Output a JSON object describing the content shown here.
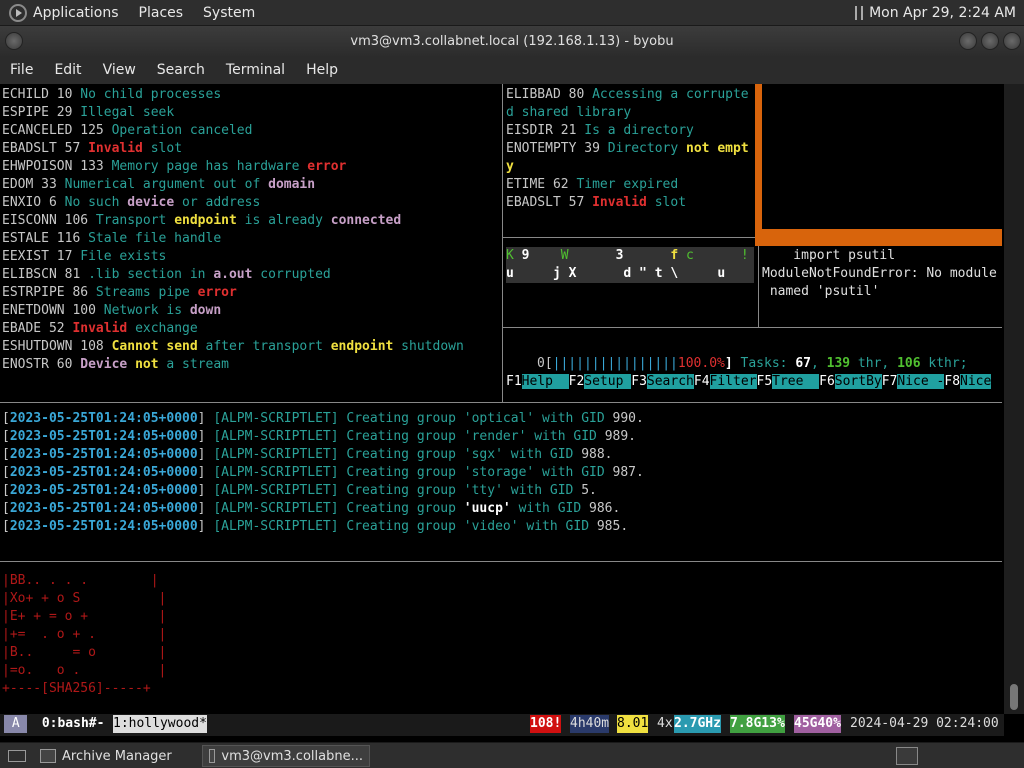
{
  "topbar": {
    "menus": [
      "Applications",
      "Places",
      "System"
    ],
    "datetime": "Mon Apr 29, 2:24 AM"
  },
  "window": {
    "title": "vm3@vm3.collabnet.local (192.168.1.13) - byobu"
  },
  "menubar": [
    "File",
    "Edit",
    "View",
    "Search",
    "Terminal",
    "Help"
  ],
  "errno_left": [
    [
      [
        "ECHILD 10 ",
        "w"
      ],
      [
        "No child processes",
        "c"
      ]
    ],
    [
      [
        "ESPIPE 29 ",
        "w"
      ],
      [
        "Illegal seek",
        "c"
      ]
    ],
    [
      [
        "ECANCELED 125 ",
        "w"
      ],
      [
        "Operation canceled",
        "c"
      ]
    ],
    [
      [
        "EBADSLT 57 ",
        "w"
      ],
      [
        "Invalid",
        "r"
      ],
      [
        " slot",
        "c"
      ]
    ],
    [
      [
        "EHWPOISON 133 ",
        "w"
      ],
      [
        "Memory page has hardware ",
        "c"
      ],
      [
        "error",
        "r"
      ]
    ],
    [
      [
        "EDOM 33 ",
        "w"
      ],
      [
        "Numerical argument out of ",
        "c"
      ],
      [
        "domain",
        "m"
      ]
    ],
    [
      [
        "ENXIO 6 ",
        "w"
      ],
      [
        "No such ",
        "c"
      ],
      [
        "device",
        "m"
      ],
      [
        " or address",
        "c"
      ]
    ],
    [
      [
        "EISCONN 106 ",
        "w"
      ],
      [
        "Transport ",
        "c"
      ],
      [
        "endpoint",
        "y"
      ],
      [
        " is already ",
        "c"
      ],
      [
        "connected",
        "m"
      ]
    ],
    [
      [
        "ESTALE 116 ",
        "w"
      ],
      [
        "Stale file handle",
        "c"
      ]
    ],
    [
      [
        "EEXIST 17 ",
        "w"
      ],
      [
        "File exists",
        "c"
      ]
    ],
    [
      [
        "ELIBSCN 81 ",
        "w"
      ],
      [
        ".lib section in ",
        "c"
      ],
      [
        "a.out",
        "m"
      ],
      [
        " corrupted",
        "c"
      ]
    ],
    [
      [
        "ESTRPIPE 86 ",
        "w"
      ],
      [
        "Streams pipe ",
        "c"
      ],
      [
        "error",
        "r"
      ]
    ],
    [
      [
        "ENETDOWN 100 ",
        "w"
      ],
      [
        "Network is ",
        "c"
      ],
      [
        "down",
        "m"
      ]
    ],
    [
      [
        "EBADE 52 ",
        "w"
      ],
      [
        "Invalid",
        "r"
      ],
      [
        " exchange",
        "c"
      ]
    ],
    [
      [
        "ESHUTDOWN 108 ",
        "w"
      ],
      [
        "Cannot send",
        "y"
      ],
      [
        " after transport ",
        "c"
      ],
      [
        "endpoint",
        "y"
      ],
      [
        " shutdown",
        "c"
      ]
    ],
    [
      [
        "ENOSTR 60 ",
        "w"
      ],
      [
        "Device",
        "m"
      ],
      [
        " ",
        "w"
      ],
      [
        "not",
        "y"
      ],
      [
        " a stream",
        "c"
      ]
    ]
  ],
  "errno_right": [
    [
      [
        "ELIBBAD 80 ",
        "w"
      ],
      [
        "Accessing a corrupte",
        "c"
      ]
    ],
    [
      [
        "d shared library",
        "c"
      ]
    ],
    [
      [
        "EISDIR 21 ",
        "w"
      ],
      [
        "Is a directory",
        "c"
      ]
    ],
    [
      [
        "ENOTEMPTY 39 ",
        "w"
      ],
      [
        "Directory ",
        "c"
      ],
      [
        "not empt",
        "y"
      ]
    ],
    [
      [
        "y",
        "y"
      ]
    ],
    [
      [
        "ETIME 62 ",
        "w"
      ],
      [
        "Timer expired",
        "c"
      ]
    ],
    [
      [
        "EBADSLT 57 ",
        "w"
      ],
      [
        "Invalid",
        "r"
      ],
      [
        " slot",
        "c"
      ]
    ]
  ],
  "gauge_row1": [
    [
      "K",
      "g"
    ],
    [
      " 9    ",
      "bw"
    ],
    [
      "W",
      "g"
    ],
    [
      "      3      ",
      "bw"
    ],
    [
      "f",
      "y"
    ],
    [
      " c      !",
      "g"
    ]
  ],
  "gauge_row2": "u     j X      d \" t \\     u",
  "python": [
    "    import psutil",
    "ModuleNotFoundError: No module",
    " named 'psutil'"
  ],
  "htop": {
    "cpu_label": "0[",
    "cpu_bar": "||||||||||||||||",
    "cpu_pct": "100.0%",
    "close": "]",
    "tasks_label": " Tasks: ",
    "tasks": "67",
    ", ": ", ",
    "thr": "139",
    " thr_label": " thr, ",
    "kthr": "106",
    "kthr_label": " kthr;",
    "keys": [
      {
        "k": "F1",
        "v": "Help  "
      },
      {
        "k": "F2",
        "v": "Setup "
      },
      {
        "k": "F3",
        "v": "Search"
      },
      {
        "k": "F4",
        "v": "Filter"
      },
      {
        "k": "F5",
        "v": "Tree  "
      },
      {
        "k": "F6",
        "v": "SortBy"
      },
      {
        "k": "F7",
        "v": "Nice -"
      },
      {
        "k": "F8",
        "v": "Nice"
      }
    ]
  },
  "log": {
    "timestamp": "2023-05-25T01:24:05+0000",
    "tag": "[ALPM-SCRIPTLET]",
    "entries": [
      {
        "group": "'optical'",
        "gid": "990"
      },
      {
        "group": "'render'",
        "gid": "989"
      },
      {
        "group": "'sgx'",
        "gid": "988"
      },
      {
        "group": "'storage'",
        "gid": "987"
      },
      {
        "group": "'tty'",
        "gid": "5"
      },
      {
        "group": "'uucp'",
        "gid": "986"
      },
      {
        "group": "'video'",
        "gid": "985"
      }
    ]
  },
  "randomart": [
    "|BB.. . . .        |",
    "|Xo+ + o S          |",
    "|E+ + = o +         |",
    "|+=  . o + .        |",
    "|B..     = o        |",
    "|=o.   o .          |",
    "+----[SHA256]-----+"
  ],
  "statusbar": {
    "a": " A ",
    "win0": " 0:bash#- ",
    "win1": "1:hollywood*",
    "warn": "108!",
    "uptime": "4h40m",
    "load": "8.01",
    "cpu": "4x",
    "ghz": "2.7GHz",
    "mem": "7.8G13%",
    "disk": "45G40%",
    "datetime": "2024-04-29 02:24:00"
  },
  "taskbar": {
    "items": [
      "Archive Manager",
      "vm3@vm3.collabne..."
    ]
  }
}
